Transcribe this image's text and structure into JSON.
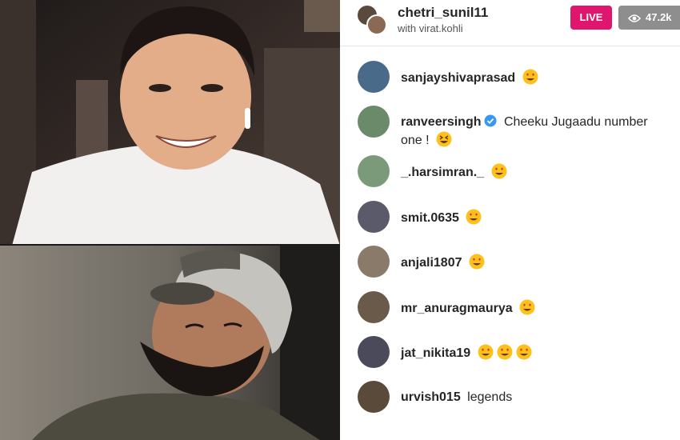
{
  "host": {
    "username": "chetri_sunil11",
    "subtitle": "with virat.kohli",
    "live_label": "LIVE",
    "viewer_count": "47.2k"
  },
  "comments": [
    {
      "user": "sanjayshivaprasad",
      "message": "",
      "emojis": [
        "heart-eyes-emoji"
      ],
      "avatar_color": "#4a6a8a"
    },
    {
      "user": "ranveersingh",
      "verified": true,
      "message": "Cheeku Jugaadu number",
      "message_cont": "one !",
      "emojis": [
        "grinning-squint-emoji"
      ],
      "avatar_color": "#6a8a6a"
    },
    {
      "user": "_.harsimran._",
      "message": "",
      "emojis": [
        "heart-eyes-emoji"
      ],
      "avatar_color": "#7a9a7a"
    },
    {
      "user": "smit.0635",
      "message": "",
      "emojis": [
        "heart-eyes-emoji"
      ],
      "avatar_color": "#5a5a6a"
    },
    {
      "user": "anjali1807",
      "message": "",
      "emojis": [
        "heart-eyes-emoji"
      ],
      "avatar_color": "#8a7a6a"
    },
    {
      "user": "mr_anuragmaurya",
      "message": "",
      "emojis": [
        "heart-eyes-emoji"
      ],
      "avatar_color": "#6a5a4a"
    },
    {
      "user": "jat_nikita19",
      "message": "",
      "emojis": [
        "heart-eyes-emoji",
        "heart-eyes-emoji",
        "heart-eyes-emoji"
      ],
      "avatar_color": "#4a4a5a"
    },
    {
      "user": "urvish015",
      "message": "legends",
      "emojis": [],
      "avatar_color": "#5a4a3a"
    }
  ],
  "colors": {
    "live": "#e0156e",
    "viewers_bg": "#8e8e8e",
    "verified": "#3897f0",
    "emoji_face": "#fcc21b"
  }
}
